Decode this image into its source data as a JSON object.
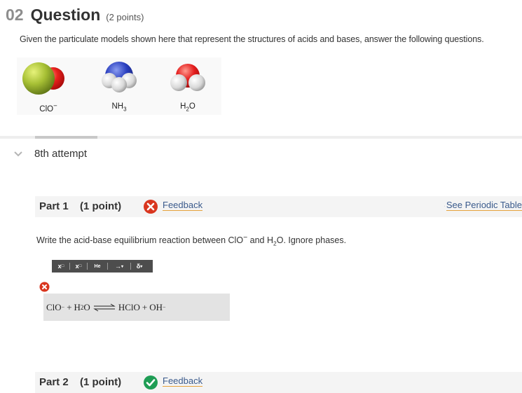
{
  "question": {
    "number": "02",
    "title": "Question",
    "points": "(2 points)",
    "prompt": "Given the particulate models shown here that represent the structures of acids and bases, answer the following questions."
  },
  "models": [
    {
      "formula": "ClO",
      "charge": "−"
    },
    {
      "formula": "NH",
      "sub": "3"
    },
    {
      "formula": "H",
      "sub": "2",
      "tail": "O"
    }
  ],
  "attempt": {
    "label": "8th attempt"
  },
  "parts": [
    {
      "title": "Part 1",
      "points": "(1 point)",
      "status": "incorrect",
      "feedback": "Feedback",
      "periodic": "See Periodic Table",
      "instruction": {
        "a": "Write the acid-base equilibrium reaction between ClO",
        "charge": "−",
        "b": " and H",
        "sub": "2",
        "c": "O. Ignore phases."
      },
      "toolbar": [
        "x",
        "x",
        "He",
        "→",
        "δ"
      ],
      "answer": {
        "lhs1": "ClO",
        "lhs1_charge": "−",
        "plus1": "+",
        "lhs2": "H",
        "lhs2_sub": "2",
        "lhs2_tail": "O",
        "rhs1": "HClO",
        "plus2": "+",
        "rhs2": "OH",
        "rhs2_charge": "−"
      }
    },
    {
      "title": "Part 2",
      "points": "(1 point)",
      "status": "correct",
      "feedback": "Feedback"
    }
  ],
  "colors": {
    "incorrect": "#d9361f",
    "correct": "#1f9d55",
    "link": "#3a5a8c",
    "underline": "#e6a23c"
  }
}
